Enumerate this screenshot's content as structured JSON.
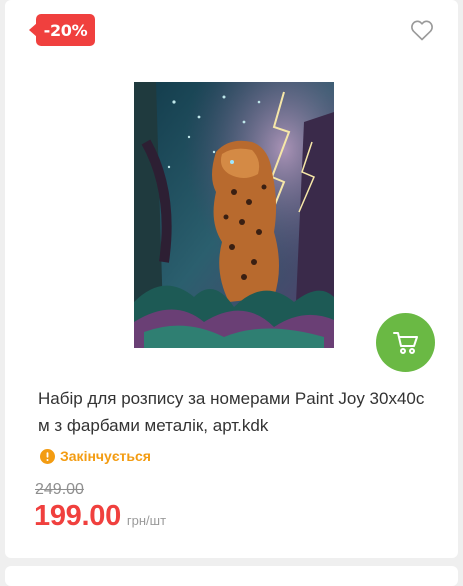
{
  "product": {
    "discount_badge": "-20%",
    "title": "Набір для розпису за номерами Paint Joy 30x40см з фарбами металік, арт.kdk",
    "stock_status": "Закінчується",
    "old_price": "249.00",
    "price": "199.00",
    "unit": "грн/шт"
  },
  "icons": {
    "wishlist": "heart-icon",
    "cart": "cart-icon",
    "stock": "exclamation-circle-icon"
  },
  "colors": {
    "badge": "#f0403e",
    "price": "#f0403e",
    "cart_button": "#6ab944",
    "stock_warning": "#f39c12"
  }
}
